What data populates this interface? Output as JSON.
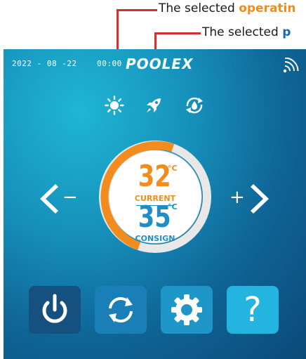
{
  "annotations": {
    "mode_prefix": "The selected ",
    "mode_word": "operatin",
    "power_prefix": "The selected ",
    "power_word": "p"
  },
  "status_bar": {
    "date": "2022 - 08 -22",
    "time": "00:00",
    "brand": "POOLEX"
  },
  "thermostat": {
    "current_temp": "32",
    "current_unit": "°C",
    "current_label": "CURRENT",
    "setpoint_temp": "35",
    "setpoint_unit": "°C",
    "setpoint_label": "CONSIGN",
    "decrease_symbol": "−",
    "increase_symbol": "+",
    "ring_level": 0.45
  },
  "colors": {
    "orange": "#f28c1e",
    "blue": "#1e8ec7",
    "ring_track": "#e8e8e8"
  },
  "icons": {
    "mode": "sun-icon",
    "power_mode": "rocket-icon",
    "auto": "auto-cycle-icon",
    "wifi": "wifi-icon",
    "buttons": [
      "power-icon",
      "refresh-icon",
      "gear-icon",
      "question-icon"
    ]
  },
  "help_button_label": "?"
}
